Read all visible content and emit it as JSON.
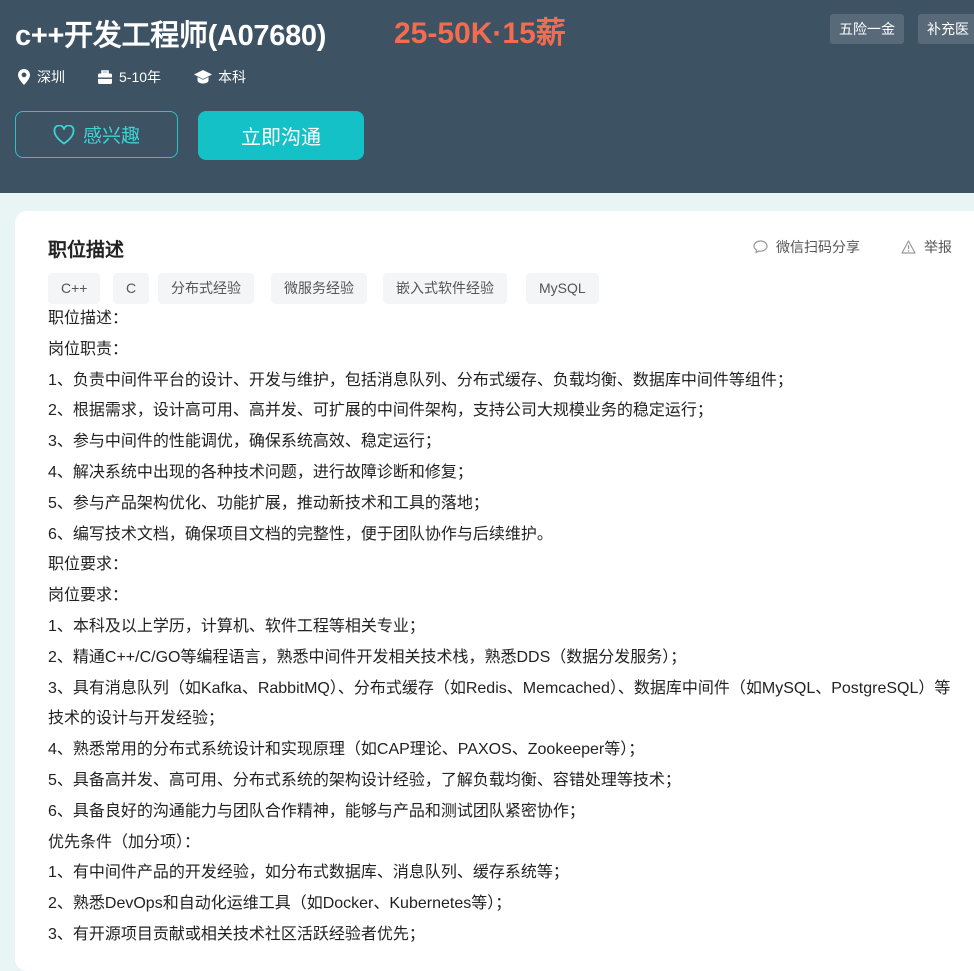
{
  "job": {
    "title": "c++开发工程师(A07680)",
    "salary": "25-50K·15薪",
    "welfare": [
      "五险一金",
      "补充医"
    ],
    "location": "深圳",
    "experience": "5-10年",
    "degree": "本科"
  },
  "actions": {
    "interest_label": "感兴趣",
    "chat_label": "立即沟通"
  },
  "section": {
    "title": "职位描述",
    "share_label": "微信扫码分享",
    "report_label": "举报"
  },
  "skills": [
    "C++",
    "C",
    "分布式经验",
    "微服务经验",
    "嵌入式软件经验",
    "MySQL"
  ],
  "description": [
    "职位描述：",
    "岗位职责：",
    "1、负责中间件平台的设计、开发与维护，包括消息队列、分布式缓存、负载均衡、数据库中间件等组件；",
    "2、根据需求，设计高可用、高并发、可扩展的中间件架构，支持公司大规模业务的稳定运行；",
    "3、参与中间件的性能调优，确保系统高效、稳定运行；",
    "4、解决系统中出现的各种技术问题，进行故障诊断和修复；",
    "5、参与产品架构优化、功能扩展，推动新技术和工具的落地；",
    "6、编写技术文档，确保项目文档的完整性，便于团队协作与后续维护。",
    "职位要求：",
    "岗位要求：",
    "1、本科及以上学历，计算机、软件工程等相关专业；",
    "2、精通C++/C/GO等编程语言，熟悉中间件开发相关技术栈，熟悉DDS（数据分发服务）；",
    "3、具有消息队列（如Kafka、RabbitMQ）、分布式缓存（如Redis、Memcached）、数据库中间件（如MySQL、PostgreSQL）等技术的设计与开发经验；",
    "4、熟悉常用的分布式系统设计和实现原理（如CAP理论、PAXOS、Zookeeper等）；",
    "5、具备高并发、高可用、分布式系统的架构设计经验，了解负载均衡、容错处理等技术；",
    "6、具备良好的沟通能力与团队合作精神，能够与产品和测试团队紧密协作；",
    "优先条件（加分项）：",
    "1、有中间件产品的开发经验，如分布式数据库、消息队列、缓存系统等；",
    "2、熟悉DevOps和自动化运维工具（如Docker、Kubernetes等）；",
    "3、有开源项目贡献或相关技术社区活跃经验者优先；"
  ]
}
